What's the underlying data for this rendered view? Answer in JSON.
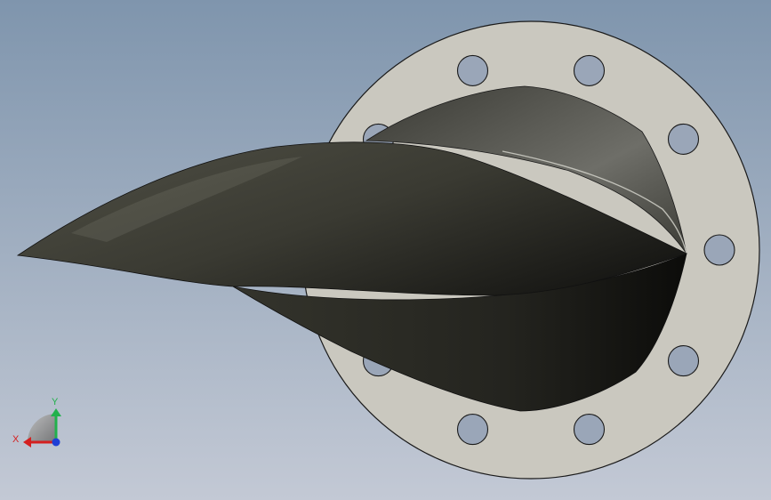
{
  "viewport": {
    "background_top": "#7f95ad",
    "background_bottom": "#c3c9d5"
  },
  "model": {
    "flange": {
      "face_color": "#cac8bf",
      "edge_color": "#1a1a1a",
      "bolt_hole_count": 10
    },
    "blade": {
      "dark_color": "#1e1e1a",
      "mid_color": "#3e3e36",
      "light_color": "#6a6a62"
    }
  },
  "triad": {
    "x_label": "X",
    "y_label": "Y",
    "x_color": "#d42020",
    "y_color": "#22b14c",
    "z_color": "#1f3fd6",
    "plane_color": "#8e8e8e"
  }
}
